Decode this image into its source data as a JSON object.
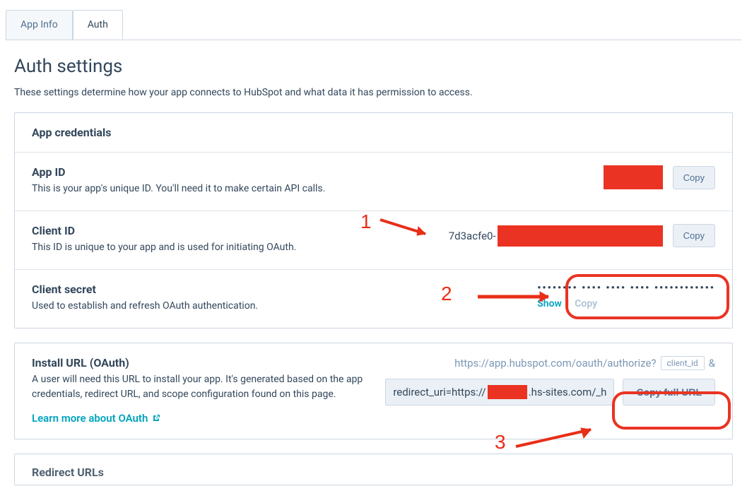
{
  "tabs": {
    "app_info": "App Info",
    "auth": "Auth"
  },
  "page": {
    "title": "Auth settings",
    "subtitle": "These settings determine how your app connects to HubSpot and what data it has permission to access."
  },
  "credentials": {
    "header": "App credentials",
    "app_id": {
      "title": "App ID",
      "desc": "This is your app's unique ID. You'll need it to make certain API calls.",
      "copy_label": "Copy"
    },
    "client_id": {
      "title": "Client ID",
      "desc": "This ID is unique to your app and is used for initiating OAuth.",
      "value_prefix": "7d3acfe0-",
      "copy_label": "Copy"
    },
    "client_secret": {
      "title": "Client secret",
      "desc": "Used to establish and refresh OAuth authentication.",
      "masked": "•••••••• •••• •••• •••• ••••••••••••",
      "show_label": "Show",
      "copy_label": "Copy"
    }
  },
  "install": {
    "title": "Install URL (OAuth)",
    "desc": "A user will need this URL to install your app. It's generated based on the app credentials, redirect URL, and scope configuration found on this page.",
    "learn_label": "Learn more about OAuth",
    "url_prefix": "https://app.hubspot.com/oauth/authorize?",
    "chip": "client_id",
    "amp": "&",
    "redirect_pre": "redirect_uri=https://",
    "redirect_post": ".hs-sites.com/_h",
    "copy_full_label": "Copy full URL"
  },
  "redirect": {
    "title": "Redirect URLs"
  },
  "anno": {
    "n1": "1",
    "n2": "2",
    "n3": "3"
  }
}
